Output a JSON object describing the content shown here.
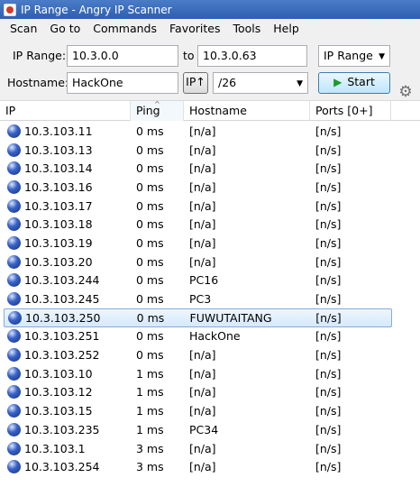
{
  "window": {
    "title": "IP Range - Angry IP Scanner"
  },
  "menu": [
    "Scan",
    "Go to",
    "Commands",
    "Favorites",
    "Tools",
    "Help"
  ],
  "toolbar": {
    "ip_range_label": "IP Range:",
    "ip_start": "10.3.0.0",
    "to_label": "to",
    "ip_end": "10.3.0.63",
    "feeder_select": "IP Range",
    "hostname_label": "Hostname:",
    "hostname_value": "HackOne",
    "ip_up_button": "IP↑",
    "netmask_select": "/26",
    "start_label": "Start"
  },
  "table": {
    "columns": [
      "IP",
      "Ping",
      "Hostname",
      "Ports [0+]"
    ],
    "rows": [
      {
        "ip": "10.3.103.11",
        "ping": "0 ms",
        "host": "[n/a]",
        "ports": "[n/s]"
      },
      {
        "ip": "10.3.103.13",
        "ping": "0 ms",
        "host": "[n/a]",
        "ports": "[n/s]"
      },
      {
        "ip": "10.3.103.14",
        "ping": "0 ms",
        "host": "[n/a]",
        "ports": "[n/s]"
      },
      {
        "ip": "10.3.103.16",
        "ping": "0 ms",
        "host": "[n/a]",
        "ports": "[n/s]"
      },
      {
        "ip": "10.3.103.17",
        "ping": "0 ms",
        "host": "[n/a]",
        "ports": "[n/s]"
      },
      {
        "ip": "10.3.103.18",
        "ping": "0 ms",
        "host": "[n/a]",
        "ports": "[n/s]"
      },
      {
        "ip": "10.3.103.19",
        "ping": "0 ms",
        "host": "[n/a]",
        "ports": "[n/s]"
      },
      {
        "ip": "10.3.103.20",
        "ping": "0 ms",
        "host": "[n/a]",
        "ports": "[n/s]"
      },
      {
        "ip": "10.3.103.244",
        "ping": "0 ms",
        "host": "PC16",
        "ports": "[n/s]"
      },
      {
        "ip": "10.3.103.245",
        "ping": "0 ms",
        "host": "PC3",
        "ports": "[n/s]"
      },
      {
        "ip": "10.3.103.250",
        "ping": "0 ms",
        "host": "FUWUTAITANG",
        "ports": "[n/s]",
        "selected": true
      },
      {
        "ip": "10.3.103.251",
        "ping": "0 ms",
        "host": "HackOne",
        "ports": "[n/s]"
      },
      {
        "ip": "10.3.103.252",
        "ping": "0 ms",
        "host": "[n/a]",
        "ports": "[n/s]"
      },
      {
        "ip": "10.3.103.10",
        "ping": "1 ms",
        "host": "[n/a]",
        "ports": "[n/s]"
      },
      {
        "ip": "10.3.103.12",
        "ping": "1 ms",
        "host": "[n/a]",
        "ports": "[n/s]"
      },
      {
        "ip": "10.3.103.15",
        "ping": "1 ms",
        "host": "[n/a]",
        "ports": "[n/s]"
      },
      {
        "ip": "10.3.103.235",
        "ping": "1 ms",
        "host": "PC34",
        "ports": "[n/s]"
      },
      {
        "ip": "10.3.103.1",
        "ping": "3 ms",
        "host": "[n/a]",
        "ports": "[n/s]"
      },
      {
        "ip": "10.3.103.254",
        "ping": "3 ms",
        "host": "[n/a]",
        "ports": "[n/s]"
      }
    ]
  }
}
